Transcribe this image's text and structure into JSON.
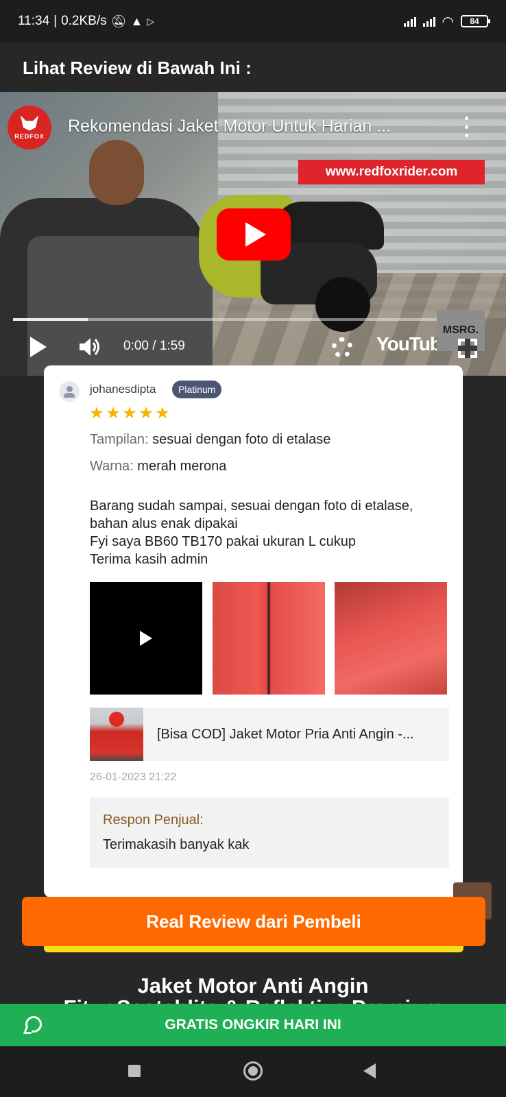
{
  "status_bar": {
    "time": "11:34",
    "network_speed": "0.2KB/s",
    "battery": "84"
  },
  "section_heading": "Lihat Review di Bawah Ini :",
  "video": {
    "channel_logo_text": "REDFOX",
    "title": "Rekomendasi Jaket Motor Untuk Harian ...",
    "url_banner": "www.redfoxrider.com",
    "watermark": "MSRG.",
    "time_display": "0:00 / 1:59",
    "platform": "YouTube",
    "buffered_fraction": 0.16
  },
  "review": {
    "username": "johanesdipta",
    "tier": "Platinum",
    "rating": 5,
    "attributes": [
      {
        "key": "Tampilan:",
        "value": "sesuai dengan foto di etalase"
      },
      {
        "key": "Warna:",
        "value": "merah merona"
      }
    ],
    "body_lines": [
      "Barang sudah sampai, sesuai dengan foto di etalase,",
      "bahan alus enak dipakai",
      "Fyi saya BB60 TB170 pakai ukuran L cukup",
      "Terima kasih admin"
    ],
    "product_title": "[Bisa COD] Jaket Motor Pria Anti Angin -...",
    "timestamp": "26-01-2023 21:22",
    "seller_response_label": "Respon Penjual:",
    "seller_response": "Terimakasih banyak kak"
  },
  "cta_review_label": "Real Review dari Pembeli",
  "product_heading": "Jaket Motor Anti Angin",
  "product_subheading": "Fitur Scotchlite & Reflektive Premium",
  "whatsapp_cta": "GRATIS ONGKIR HARI INI",
  "colors": {
    "orange": "#ff6a00",
    "green": "#1faf54",
    "yellow": "#f5dd1a",
    "youtube_red": "#ff0000"
  }
}
